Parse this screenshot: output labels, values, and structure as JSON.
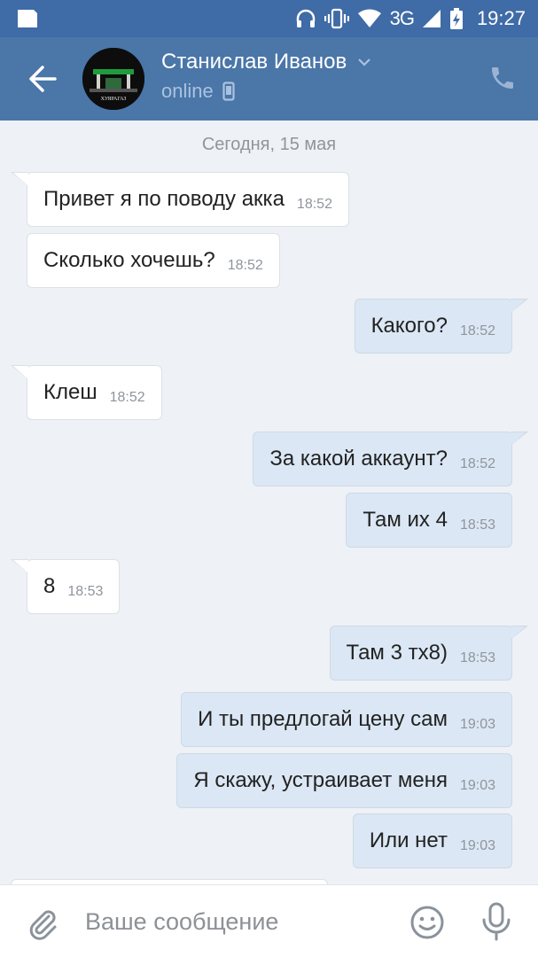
{
  "status_bar": {
    "network": "3G",
    "time": "19:27",
    "icons": [
      "sim-card-icon",
      "headphones-icon",
      "vibrate-icon",
      "wifi-icon",
      "signal-icon",
      "battery-charging-icon"
    ]
  },
  "header": {
    "back_icon": "arrow-left-icon",
    "contact_name": "Станислав Иванов",
    "presence": "online",
    "presence_icon": "mobile-device-icon",
    "avatar_caption": "ХУЯРАГАЗ",
    "call_icon": "phone-icon"
  },
  "chat": {
    "date_separator": "Сегодня, 15 мая",
    "messages": [
      {
        "direction": "in",
        "text": "Привет я по поводу акка",
        "time": "18:52"
      },
      {
        "direction": "in",
        "text": "Сколько хочешь?",
        "time": "18:52"
      },
      {
        "direction": "out",
        "text": "Какого?",
        "time": "18:52"
      },
      {
        "direction": "in",
        "text": "Клеш",
        "time": "18:52"
      },
      {
        "direction": "out",
        "text": "За какой аккаунт?",
        "time": "18:52"
      },
      {
        "direction": "out",
        "text": "Там их 4",
        "time": "18:53"
      },
      {
        "direction": "in",
        "text": "8",
        "time": "18:53"
      },
      {
        "direction": "out",
        "text": "Там 3 тх8)",
        "time": "18:53"
      },
      {
        "direction": "out",
        "text": "И ты предлогай цену сам",
        "time": "19:03"
      },
      {
        "direction": "out",
        "text": "Я скажу, устраивает меня",
        "time": "19:03"
      },
      {
        "direction": "out",
        "text": "Или нет",
        "time": "19:03"
      }
    ]
  },
  "input_bar": {
    "placeholder": "Ваше сообщение",
    "value": "",
    "icons": [
      "paperclip-icon",
      "emoji-icon",
      "microphone-icon"
    ]
  },
  "colors": {
    "header": "#4a76a8",
    "status_bar": "#3f6ba6",
    "background": "#eef1f5",
    "incoming_bubble": "#ffffff",
    "outgoing_bubble": "#dbe7f4",
    "muted_text": "#8f959c"
  }
}
